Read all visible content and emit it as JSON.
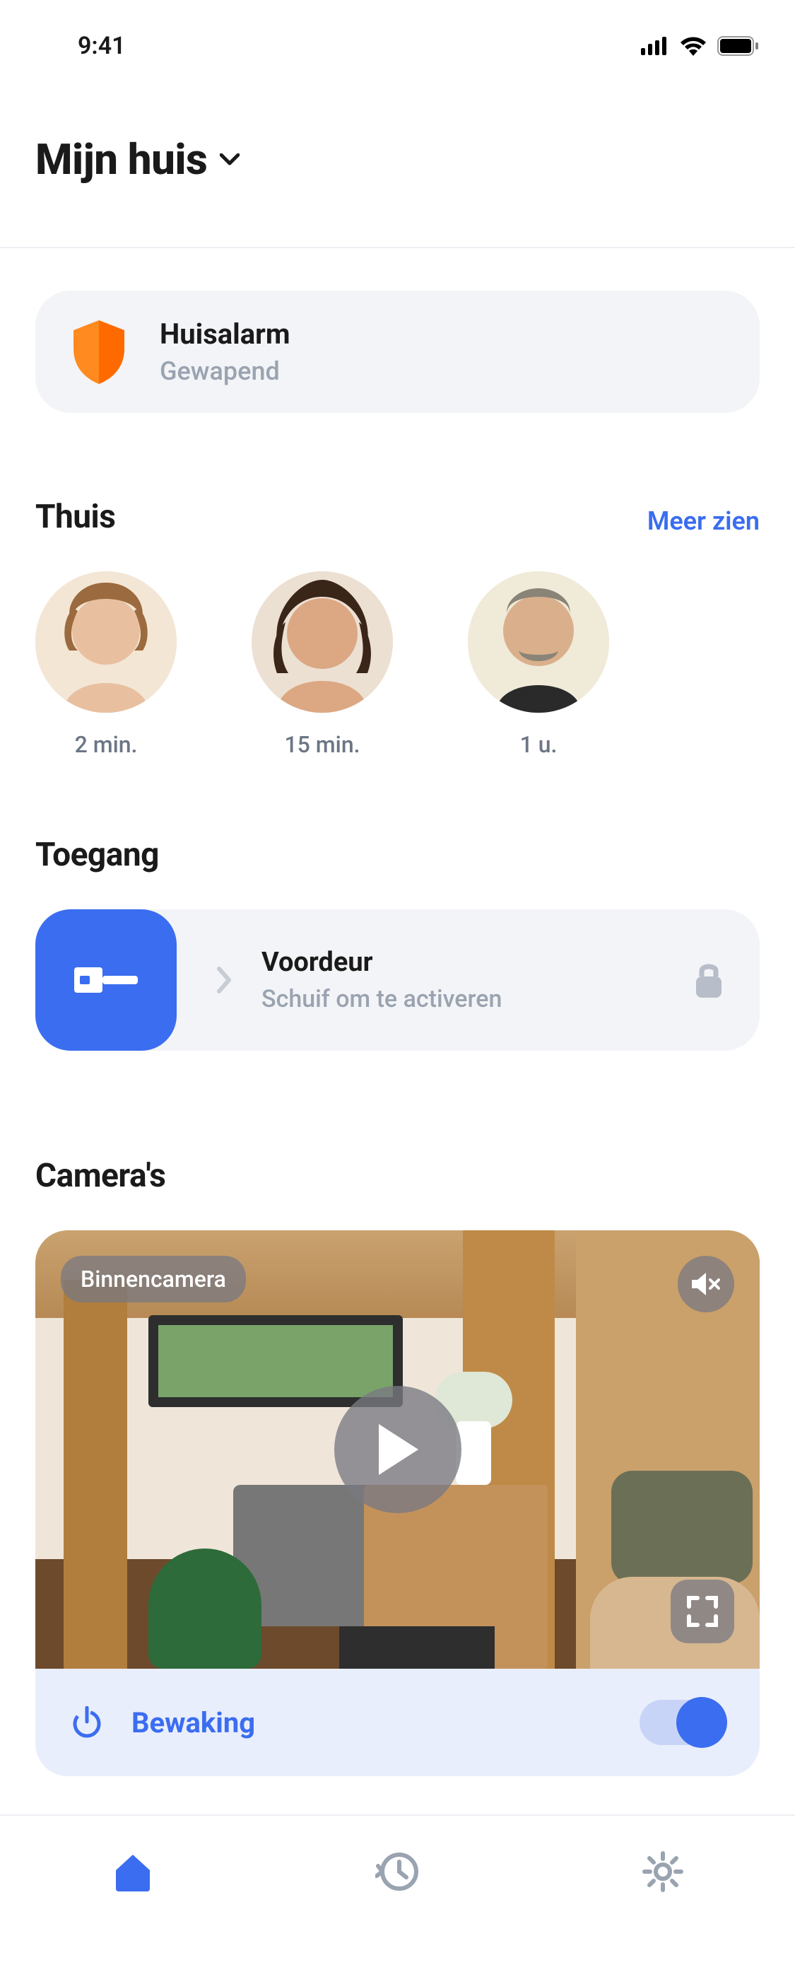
{
  "status": {
    "time": "9:41"
  },
  "header": {
    "title": "Mijn huis"
  },
  "alarm": {
    "title": "Huisalarm",
    "status": "Gewapend"
  },
  "home": {
    "section_title": "Thuis",
    "see_more": "Meer zien",
    "people": [
      {
        "time": "2 min."
      },
      {
        "time": "15 min."
      },
      {
        "time": "1 u."
      }
    ]
  },
  "access": {
    "section_title": "Toegang",
    "door_name": "Voordeur",
    "instruction": "Schuif om te activeren"
  },
  "cameras": {
    "section_title": "Camera's",
    "label": "Binnencamera",
    "monitoring_label": "Bewaking",
    "monitoring_on": true
  }
}
